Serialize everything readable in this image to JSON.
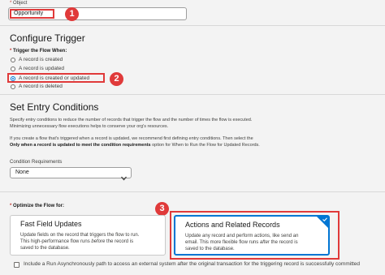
{
  "object_section": {
    "label": "Object",
    "value": "Opportunity",
    "badge": "1"
  },
  "configure_trigger": {
    "title": "Configure Trigger",
    "field_label": "Trigger the Flow When:",
    "badge": "2",
    "options": [
      {
        "label": "A record is created",
        "checked": false
      },
      {
        "label": "A record is updated",
        "checked": false
      },
      {
        "label": "A record is created or updated",
        "checked": true
      },
      {
        "label": "A record is deleted",
        "checked": false
      }
    ]
  },
  "entry_conditions": {
    "title": "Set Entry Conditions",
    "desc_line1": "Specify entry conditions to reduce the number of records that trigger the flow and the number of times the flow is executed.",
    "desc_line2": "Minimizing unnecessary flow executions helps to conserve your org's resources.",
    "note_line1": "If you create a flow that's triggered when a record is updated, we recommend first defining entry conditions. Then select the",
    "note_bold": "Only when a record is updated to meet the condition requirements",
    "note_rest": " option for When to Run the Flow for Updated Records.",
    "condition_label": "Condition Requirements",
    "condition_value": "None"
  },
  "optimize": {
    "label": "Optimize the Flow for:",
    "badge": "3",
    "fast": {
      "title": "Fast Field Updates",
      "line1": "Update fields on the record that triggers the flow to run.",
      "line2_a": "This high-performance flow runs ",
      "line2_em": "before",
      "line2_b": " the record is",
      "line3": "saved to the database."
    },
    "actions": {
      "title": "Actions and Related Records",
      "line1": "Update any record and perform actions, like send an",
      "line2_a": "email. This more flexible flow runs ",
      "line2_em": "after",
      "line2_b": " the record is",
      "line3": "saved to the database.",
      "selected": true
    }
  },
  "async_option": {
    "label": "Include a Run Asynchronously path to access an external system after the original transaction for the triggering record is successfully committed",
    "checked": false
  },
  "colors": {
    "accent": "#0176d3",
    "highlight": "#e03a3a"
  }
}
